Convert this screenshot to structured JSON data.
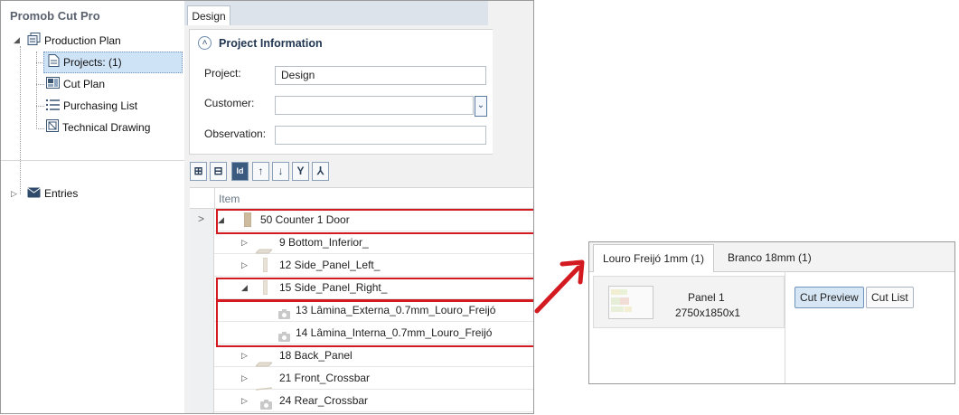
{
  "app": {
    "title": "Promob Cut Pro"
  },
  "tree": {
    "items": [
      {
        "label": "Production Plan",
        "icon": "production-plan-icon"
      },
      {
        "label": "Projects: (1)",
        "icon": "document-icon",
        "selected": true
      },
      {
        "label": "Cut Plan",
        "icon": "cut-plan-icon"
      },
      {
        "label": "Purchasing List",
        "icon": "list-icon"
      },
      {
        "label": "Technical Drawing",
        "icon": "technical-drawing-icon"
      },
      {
        "label": "Entries",
        "icon": "inbox-icon"
      }
    ]
  },
  "tabs": {
    "design": "Design"
  },
  "project_info": {
    "heading": "Project Information",
    "project_label": "Project:",
    "project_value": "Design",
    "customer_label": "Customer:",
    "customer_value": "",
    "observation_label": "Observation:",
    "observation_value": ""
  },
  "toolbar": {
    "buttons": [
      {
        "name": "expand-all-icon",
        "glyph": "⊞"
      },
      {
        "name": "collapse-all-icon",
        "glyph": "⊟"
      },
      {
        "name": "id-icon",
        "glyph": "Id"
      },
      {
        "name": "move-up-icon",
        "glyph": "↑"
      },
      {
        "name": "move-down-icon",
        "glyph": "↓"
      },
      {
        "name": "merge-icon",
        "glyph": "Y"
      },
      {
        "name": "split-icon",
        "glyph": "⅄"
      }
    ]
  },
  "grid": {
    "header": "Item",
    "row_selector": ">",
    "rows": [
      {
        "text": "50  Counter 1 Door",
        "level": 0,
        "expander": "◢",
        "icon": "cabinet-icon"
      },
      {
        "text": "9  Bottom_Inferior_",
        "level": 1,
        "expander": "▷",
        "icon": "flat-panel-icon"
      },
      {
        "text": "12  Side_Panel_Left_",
        "level": 1,
        "expander": "▷",
        "icon": "vertical-panel-icon"
      },
      {
        "text": "15  Side_Panel_Right_",
        "level": 1,
        "expander": "◢",
        "icon": "vertical-panel-icon"
      },
      {
        "text": "13  Lâmina_Externa_0.7mm_Louro_Freijó",
        "level": 2,
        "expander": "",
        "icon": "camera-icon"
      },
      {
        "text": "14  Lâmina_Interna_0.7mm_Louro_Freijó",
        "level": 2,
        "expander": "",
        "icon": "camera-icon"
      },
      {
        "text": "18  Back_Panel",
        "level": 1,
        "expander": "▷",
        "icon": "flat-panel-icon"
      },
      {
        "text": "21  Front_Crossbar",
        "level": 1,
        "expander": "▷",
        "icon": "line-icon"
      },
      {
        "text": "24  Rear_Crossbar",
        "level": 1,
        "expander": "▷",
        "icon": "camera-icon"
      }
    ]
  },
  "cut_window": {
    "tabs": [
      "Louro Freijó 1mm (1)",
      "Branco 18mm (1)"
    ],
    "panel_name": "Panel 1",
    "panel_dims": "2750x1850x1",
    "buttons": {
      "cut_preview": "Cut Preview",
      "cut_list": "Cut List"
    }
  },
  "colors": {
    "highlight": "#d41a21",
    "selection": "#cfe3f7",
    "accent": "#2c4f7a"
  }
}
